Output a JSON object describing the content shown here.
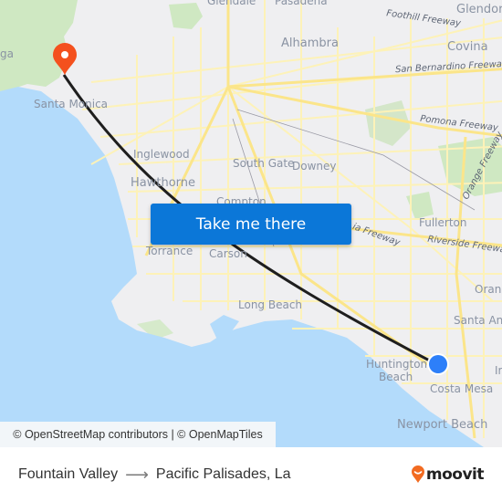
{
  "map": {
    "places": [
      {
        "id": "glendale",
        "label": "Glendale"
      },
      {
        "id": "pasadena",
        "label": "Pasadena"
      },
      {
        "id": "glendora",
        "label": "Glendora"
      },
      {
        "id": "alhambra",
        "label": "Alhambra"
      },
      {
        "id": "covina",
        "label": "Covina"
      },
      {
        "id": "topanga",
        "label": "ga"
      },
      {
        "id": "santa-monica",
        "label": "Santa Monica"
      },
      {
        "id": "inglewood",
        "label": "Inglewood"
      },
      {
        "id": "south-gate",
        "label": "South Gate"
      },
      {
        "id": "downey",
        "label": "Downey"
      },
      {
        "id": "hawthorne",
        "label": "Hawthorne"
      },
      {
        "id": "compton",
        "label": "Compton"
      },
      {
        "id": "fullerton",
        "label": "Fullerton"
      },
      {
        "id": "torrance",
        "label": "Torrance"
      },
      {
        "id": "carson",
        "label": "Carson"
      },
      {
        "id": "orange",
        "label": "Orange"
      },
      {
        "id": "long-beach",
        "label": "Long Beach"
      },
      {
        "id": "santa-ana",
        "label": "Santa Ana"
      },
      {
        "id": "huntington-beach-1",
        "label": "Huntington"
      },
      {
        "id": "huntington-beach-2",
        "label": "Beach"
      },
      {
        "id": "irvine",
        "label": "Ir"
      },
      {
        "id": "costa-mesa",
        "label": "Costa Mesa"
      },
      {
        "id": "newport-beach",
        "label": "Newport Beach"
      }
    ],
    "roads": [
      {
        "id": "foothill",
        "label": "Foothill Freeway"
      },
      {
        "id": "san-bernardino",
        "label": "San Bernardino Freeway"
      },
      {
        "id": "pomona",
        "label": "Pomona Freeway"
      },
      {
        "id": "orange-fwy",
        "label": "Orange Freeway"
      },
      {
        "id": "artesia",
        "label": "ia Freeway"
      },
      {
        "id": "riverside",
        "label": "Riverside Freeway"
      }
    ],
    "origin": "Fountain Valley",
    "destination": "Pacific Palisades, La",
    "colors": {
      "route": "#1e1e1e",
      "destination_pin": "#f4511e",
      "origin_dot": "#2d7ff9",
      "water": "#b3dbfb",
      "park": "#cfe8c2",
      "road": "#fdf2b8"
    }
  },
  "cta": {
    "label": "Take me there"
  },
  "attribution": {
    "text": "© OpenStreetMap contributors | © OpenMapTiles"
  },
  "footer": {
    "from": "Fountain Valley",
    "arrow": "⟶",
    "to": "Pacific Palisades, La",
    "brand": "moovit",
    "brand_color": "#f26b21"
  }
}
